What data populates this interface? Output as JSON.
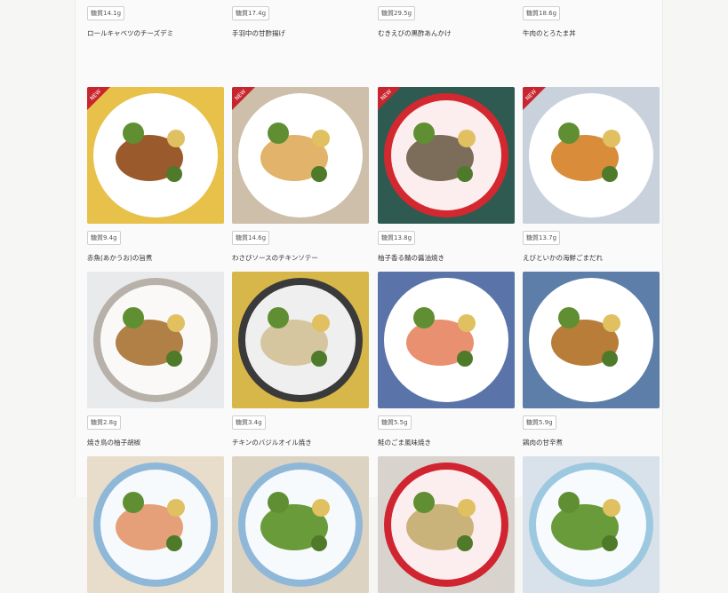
{
  "products": [
    {
      "carbs": "糖質14.1g",
      "name": "ロールキャベツのチーズデミ",
      "is_new": false,
      "bg": "#c9b58f",
      "plate": "#8fb8d8",
      "food": "#b56a3a"
    },
    {
      "carbs": "糖質17.4g",
      "name": "手羽中の甘酢揚げ",
      "is_new": false,
      "bg": "#d9d3c6",
      "plate": "#ffffff",
      "food": "#8a4b22"
    },
    {
      "carbs": "糖質29.5g",
      "name": "むきえびの黒酢あんかけ",
      "is_new": false,
      "bg": "#1e2b4a",
      "plate": "#d02430",
      "food": "#e8d8a0"
    },
    {
      "carbs": "糖質18.6g",
      "name": "牛肉のとろたま丼",
      "is_new": false,
      "bg": "#e9ecef",
      "plate": "#9cc8e0",
      "food": "#f1d24a"
    },
    {
      "carbs": "糖質9.4g",
      "name": "赤魚(あかうお)の旨煮",
      "is_new": true,
      "bg": "#e7c14a",
      "plate": "#ffffff",
      "food": "#9b5a2c"
    },
    {
      "carbs": "糖質14.6g",
      "name": "わさびソースのチキンソテー",
      "is_new": true,
      "bg": "#cdbfa9",
      "plate": "#ffffff",
      "food": "#e2b36a"
    },
    {
      "carbs": "糖質13.8g",
      "name": "柚子香る鯖の醤油焼き",
      "is_new": true,
      "bg": "#2f5a52",
      "plate": "#d3282f",
      "food": "#7b6d5a"
    },
    {
      "carbs": "糖質13.7g",
      "name": "えびといかの海鮮ごまだれ",
      "is_new": true,
      "bg": "#c9d2dc",
      "plate": "#ffffff",
      "food": "#d98c3a"
    },
    {
      "carbs": "糖質2.8g",
      "name": "焼き鳥の柚子胡椒",
      "is_new": false,
      "bg": "#e9eaec",
      "plate": "#b7b1aa",
      "food": "#b08046"
    },
    {
      "carbs": "糖質3.4g",
      "name": "チキンのバジルオイル焼き",
      "is_new": false,
      "bg": "#d7b74a",
      "plate": "#3a3a3a",
      "food": "#d6c6a0"
    },
    {
      "carbs": "糖質5.5g",
      "name": "鮭のごま風味焼き",
      "is_new": false,
      "bg": "#5a73a8",
      "plate": "#ffffff",
      "food": "#e89070"
    },
    {
      "carbs": "糖質5.9g",
      "name": "鶏肉の甘辛煮",
      "is_new": false,
      "bg": "#5d7ea8",
      "plate": "#ffffff",
      "food": "#b97d3a"
    },
    {
      "carbs": "",
      "name": "",
      "is_new": false,
      "bg": "#e8dccb",
      "plate": "#8fb8d8",
      "food": "#e5a07a"
    },
    {
      "carbs": "",
      "name": "",
      "is_new": false,
      "bg": "#ddd3c2",
      "plate": "#8fb8d8",
      "food": "#6a9b3a"
    },
    {
      "carbs": "",
      "name": "",
      "is_new": false,
      "bg": "#d8d3cc",
      "plate": "#d02430",
      "food": "#c9b37a"
    },
    {
      "carbs": "",
      "name": "",
      "is_new": false,
      "bg": "#d9e2ea",
      "plate": "#9cc8e0",
      "food": "#6a9b3a"
    }
  ],
  "ribbon_text": "NEW"
}
